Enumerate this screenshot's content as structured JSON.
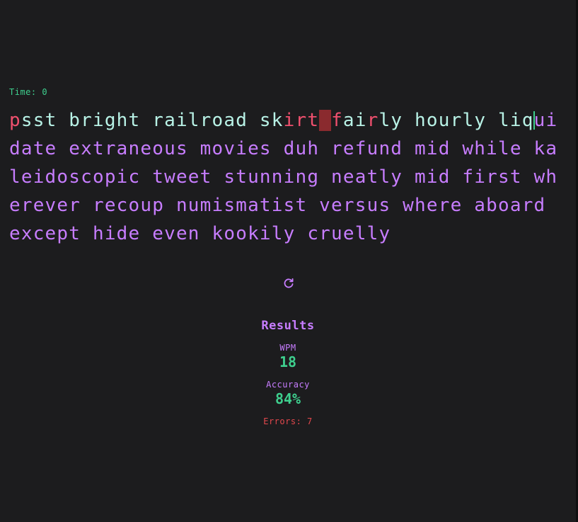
{
  "timer": {
    "label": "Time: 0"
  },
  "typing": {
    "segments": [
      {
        "text": "p",
        "state": "wrong"
      },
      {
        "text": "sst bright railroad sk",
        "state": "correct"
      },
      {
        "text": "irt",
        "state": "wrong"
      },
      {
        "text": " ",
        "state": "wrong-space"
      },
      {
        "text": "f",
        "state": "wrong"
      },
      {
        "text": "ai",
        "state": "correct"
      },
      {
        "text": "r",
        "state": "wrong"
      },
      {
        "text": "ly hourly liq",
        "state": "correct"
      },
      {
        "text": "",
        "state": "caret"
      },
      {
        "text": "uidate extraneous movies duh refund mid while kaleidoscopic tweet stunning neatly mid first wherever recoup numismatist versus where aboard except hide even kookily cruelly",
        "state": "pending"
      }
    ]
  },
  "controls": {
    "restart_icon": "restart-icon"
  },
  "results": {
    "title": "Results",
    "wpm_label": "WPM",
    "wpm_value": "18",
    "accuracy_label": "Accuracy",
    "accuracy_value": "84%",
    "errors": "Errors: 7"
  },
  "colors": {
    "background": "#1c1c1e",
    "correct": "#b8f2e6",
    "wrong": "#f0506e",
    "pending": "#c77dff",
    "accent_green": "#3ecf8e",
    "error_red": "#e5484d"
  }
}
